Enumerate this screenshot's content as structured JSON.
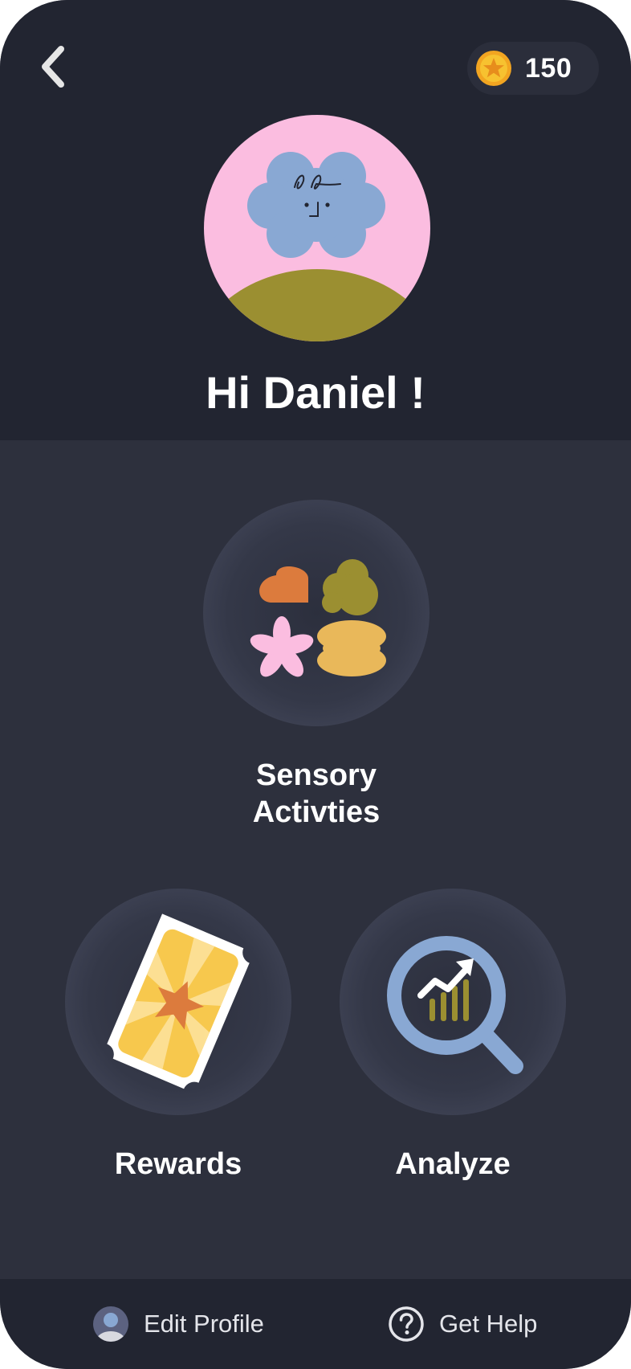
{
  "header": {
    "back_icon": "chevron-left-icon",
    "coins": {
      "icon": "coin-star-icon",
      "count": "150"
    }
  },
  "profile": {
    "avatar_icon": "flower-avatar-icon",
    "greeting": "Hi Daniel !"
  },
  "activities": [
    {
      "id": "sensory",
      "label": "Sensory\nActivties",
      "icon": "sensory-shapes-icon"
    },
    {
      "id": "rewards",
      "label": "Rewards",
      "icon": "reward-ticket-icon"
    },
    {
      "id": "analyze",
      "label": "Analyze",
      "icon": "analyze-magnifier-icon"
    }
  ],
  "bottom_bar": {
    "edit_profile": {
      "label": "Edit Profile",
      "icon": "user-avatar-icon"
    },
    "get_help": {
      "label": "Get Help",
      "icon": "help-circle-icon"
    }
  },
  "colors": {
    "top_background": "#222531",
    "main_background": "#2d303d",
    "avatar_pink": "#fbbde0",
    "avatar_blue": "#89a8d3",
    "avatar_olive": "#9b8f31",
    "accent_orange": "#dc7b3d",
    "accent_yellow": "#e9b85a",
    "coin_gold": "#f2a521"
  }
}
